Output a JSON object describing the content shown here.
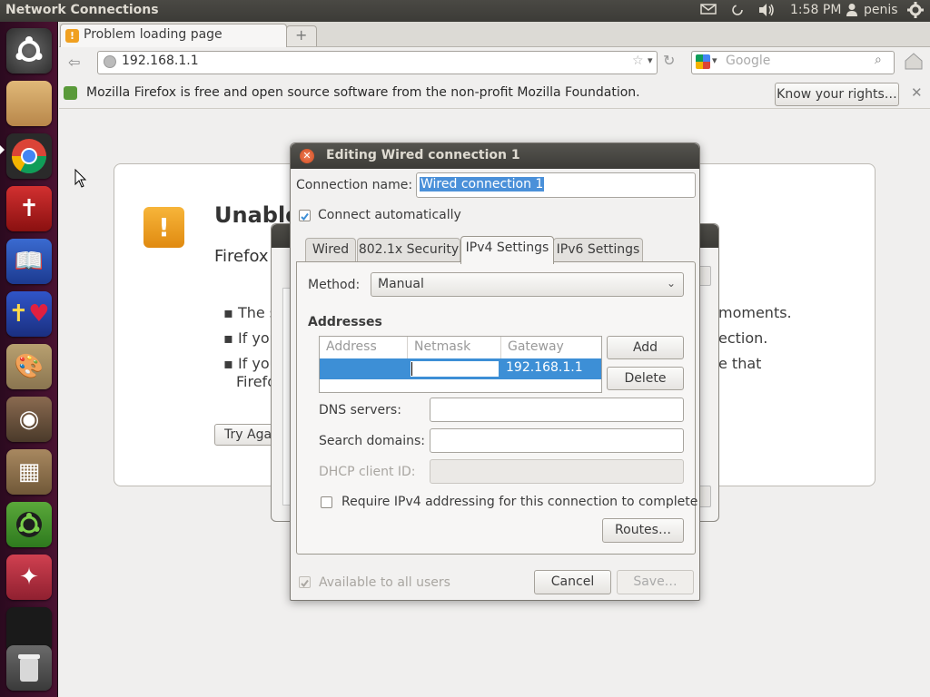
{
  "top_panel": {
    "title": "Network Connections",
    "time": "1:58 PM",
    "user": "penis"
  },
  "launcher": {
    "items": [
      "ubuntu-logo",
      "files",
      "chrome",
      "bible",
      "book-clock",
      "bible-heart",
      "paint",
      "speaker",
      "package",
      "ubuntu-one",
      "magic",
      "workspace",
      "trash"
    ]
  },
  "browser": {
    "tab_title": "Problem loading page",
    "url": "192.168.1.1",
    "search_placeholder": "Google",
    "notification": "Mozilla Firefox is free and open source software from the non-profit Mozilla Foundation.",
    "notification_button": "Know your rights…",
    "error": {
      "heading": "Unable",
      "subtext": "Firefox",
      "bullet1_start": "The s",
      "bullet1_end": "moments.",
      "bullet2_start": "If you",
      "bullet2_end": "ection.",
      "bullet3_start": "If you",
      "bullet3_start2": "Firefo",
      "bullet3_end": "e that",
      "try_again": "Try Aga"
    }
  },
  "dialog": {
    "title": "Editing Wired connection 1",
    "connection_name_label": "Connection name:",
    "connection_name_value": "Wired connection 1",
    "connect_auto_label": "Connect automatically",
    "connect_auto_checked": true,
    "tabs": [
      "Wired",
      "802.1x Security",
      "IPv4 Settings",
      "IPv6 Settings"
    ],
    "active_tab": "IPv4 Settings",
    "method_label": "Method:",
    "method_value": "Manual",
    "addresses_heading": "Addresses",
    "columns": [
      "Address",
      "Netmask",
      "Gateway"
    ],
    "rows": [
      {
        "address": "",
        "netmask": "",
        "gateway": "192.168.1.1"
      }
    ],
    "add_button": "Add",
    "delete_button": "Delete",
    "dns_label": "DNS servers:",
    "search_domains_label": "Search domains:",
    "dhcp_label": "DHCP client ID:",
    "require_label": "Require IPv4 addressing for this connection to complete",
    "routes_button": "Routes…",
    "available_label": "Available to all users",
    "cancel_button": "Cancel",
    "save_button": "Save…"
  },
  "colors": {
    "accent": "#4a90d9",
    "selection": "#3d8fd6",
    "launcher": "#3c0c2a",
    "panel": "#3c3b37"
  }
}
